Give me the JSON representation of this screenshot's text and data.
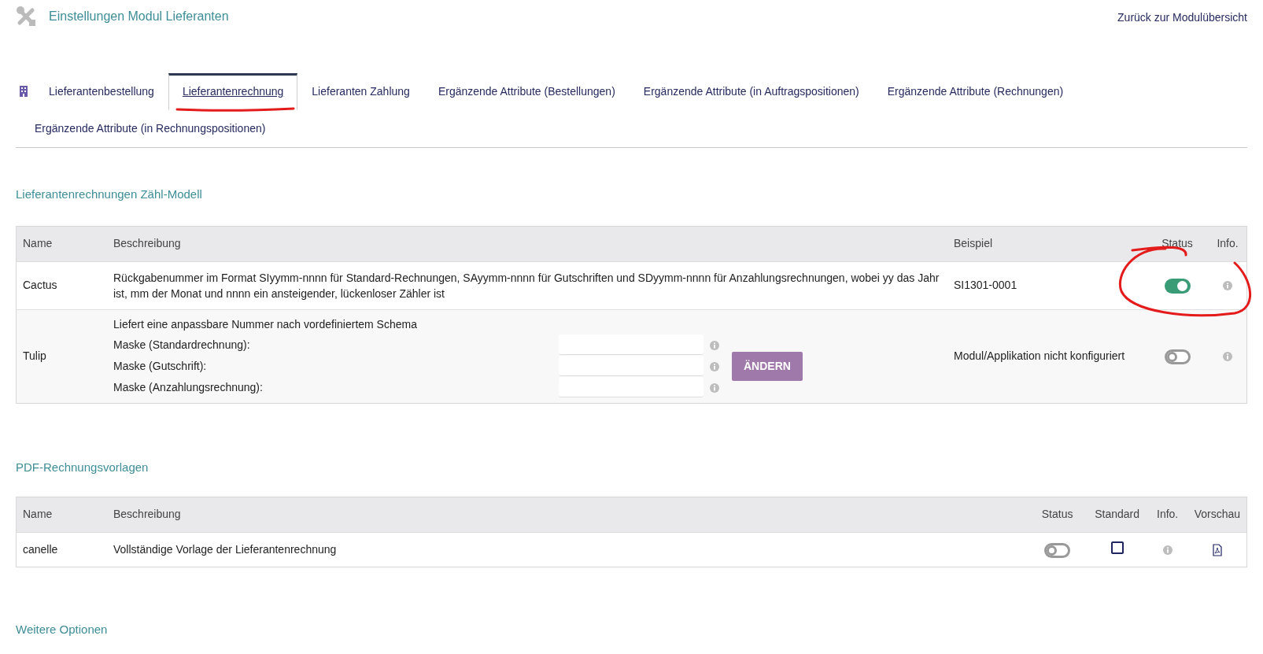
{
  "header": {
    "title": "Einstellungen Modul Lieferanten",
    "back_link": "Zurück zur Modulübersicht"
  },
  "tabs": [
    {
      "label": "Lieferantenbestellung",
      "selected": false
    },
    {
      "label": "Lieferantenrechnung",
      "selected": true
    },
    {
      "label": "Lieferanten Zahlung",
      "selected": false
    },
    {
      "label": "Ergänzende Attribute (Bestellungen)",
      "selected": false
    },
    {
      "label": "Ergänzende Attribute (in Auftragspositionen)",
      "selected": false
    },
    {
      "label": "Ergänzende Attribute (Rechnungen)",
      "selected": false
    },
    {
      "label": "Ergänzende Attribute (in Rechnungspositionen)",
      "selected": false
    }
  ],
  "numbering_section": {
    "title": "Lieferantenrechnungen Zähl-Modell",
    "columns": [
      "Name",
      "Beschreibung",
      "Beispiel",
      "Status",
      "Info."
    ],
    "rows": [
      {
        "kind": "simple",
        "name": "Cactus",
        "description": "Rückgabenummer im Format SIyymm-nnnn für Standard-Rechnungen, SAyymm-nnnn für Gutschriften und SDyymm-nnnn für Anzahlungsrechnungen, wobei yy das Jahr ist, mm der Monat und nnnn ein ansteigender, lückenloser Zähler ist",
        "example": "SI1301-0001",
        "on": true
      },
      {
        "kind": "masks",
        "name": "Tulip",
        "description": "Liefert eine anpassbare Nummer nach vordefiniertem Schema",
        "masks": [
          {
            "label": "Maske (Standardrechnung):"
          },
          {
            "label": "Maske (Gutschrift):"
          },
          {
            "label": "Maske (Anzahlungsrechnung):"
          }
        ],
        "button": "ÄNDERN",
        "example": "Modul/Applikation nicht konfiguriert",
        "on": false
      }
    ]
  },
  "templates_section": {
    "title": "PDF-Rechnungsvorlagen",
    "columns": [
      "Name",
      "Beschreibung",
      "Status",
      "Standard",
      "Info.",
      "Vorschau"
    ],
    "rows": [
      {
        "name": "canelle",
        "description": "Vollständige Vorlage der Lieferantenrechnung",
        "on": false,
        "checked": false
      }
    ]
  },
  "more_section": {
    "title": "Weitere Optionen"
  },
  "annotations": [
    {
      "kind": "underline"
    },
    {
      "kind": "circle"
    }
  ]
}
